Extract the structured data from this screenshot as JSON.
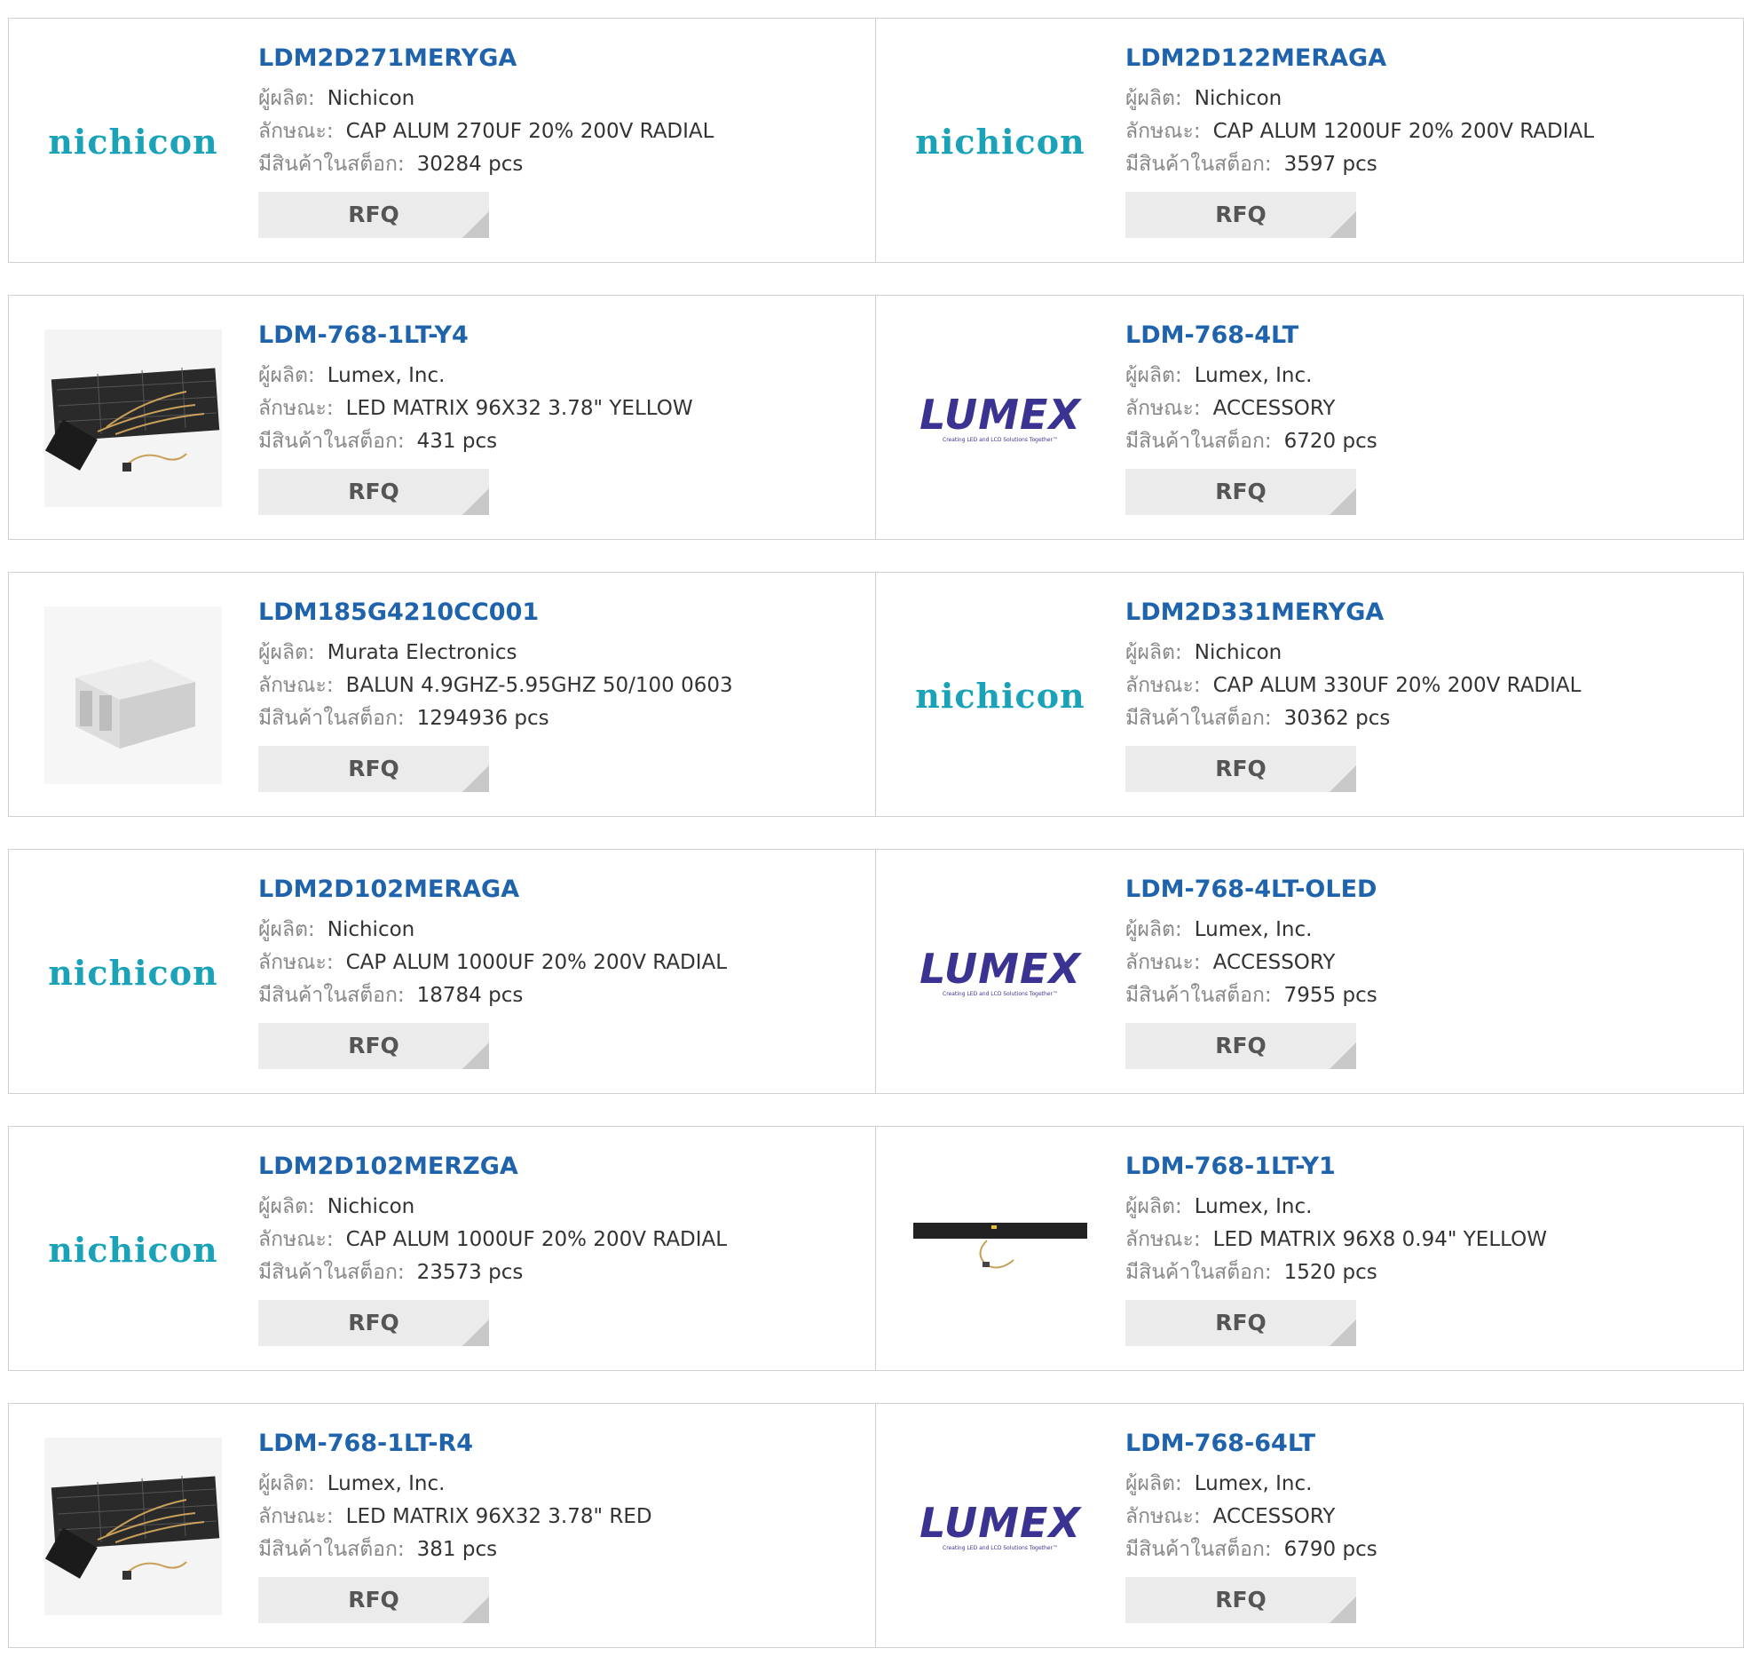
{
  "labels": {
    "manufacturer": "ผู้ผลิต:",
    "description": "ลักษณะ:",
    "stock": "มีสินค้าในสต็อก:",
    "rfq": "RFQ"
  },
  "logos": {
    "nichicon": "nichicon",
    "lumex": "LUMEX",
    "lumex_tagline": "Creating LED and LCD Solutions Together™"
  },
  "colors": {
    "title": "#1f63ad",
    "nichicon": "#1aa3b8",
    "lumex": "#3a3392"
  },
  "products": [
    {
      "part": "LDM2D271MERYGA",
      "manufacturer": "Nichicon",
      "description": "CAP ALUM 270UF 20% 200V RADIAL",
      "stock": "30284 pcs",
      "image": "nichicon-logo"
    },
    {
      "part": "LDM2D122MERAGA",
      "manufacturer": "Nichicon",
      "description": "CAP ALUM 1200UF 20% 200V RADIAL",
      "stock": "3597 pcs",
      "image": "nichicon-logo"
    },
    {
      "part": "LDM-768-1LT-Y4",
      "manufacturer": "Lumex, Inc.",
      "description": "LED MATRIX 96X32 3.78\" YELLOW",
      "stock": "431 pcs",
      "image": "led-matrix-large-photo"
    },
    {
      "part": "LDM-768-4LT",
      "manufacturer": "Lumex, Inc.",
      "description": "ACCESSORY",
      "stock": "6720 pcs",
      "image": "lumex-logo"
    },
    {
      "part": "LDM185G4210CC001",
      "manufacturer": "Murata Electronics",
      "description": "BALUN 4.9GHZ-5.95GHZ 50/100 0603",
      "stock": "1294936 pcs",
      "image": "balun-chip-photo"
    },
    {
      "part": "LDM2D331MERYGA",
      "manufacturer": "Nichicon",
      "description": "CAP ALUM 330UF 20% 200V RADIAL",
      "stock": "30362 pcs",
      "image": "nichicon-logo"
    },
    {
      "part": "LDM2D102MERAGA",
      "manufacturer": "Nichicon",
      "description": "CAP ALUM 1000UF 20% 200V RADIAL",
      "stock": "18784 pcs",
      "image": "nichicon-logo"
    },
    {
      "part": "LDM-768-4LT-OLED",
      "manufacturer": "Lumex, Inc.",
      "description": "ACCESSORY",
      "stock": "7955 pcs",
      "image": "lumex-logo"
    },
    {
      "part": "LDM2D102MERZGA",
      "manufacturer": "Nichicon",
      "description": "CAP ALUM 1000UF 20% 200V RADIAL",
      "stock": "23573 pcs",
      "image": "nichicon-logo"
    },
    {
      "part": "LDM-768-1LT-Y1",
      "manufacturer": "Lumex, Inc.",
      "description": "LED MATRIX 96X8 0.94\" YELLOW",
      "stock": "1520 pcs",
      "image": "led-matrix-bar-photo"
    },
    {
      "part": "LDM-768-1LT-R4",
      "manufacturer": "Lumex, Inc.",
      "description": "LED MATRIX 96X32 3.78\" RED",
      "stock": "381 pcs",
      "image": "led-matrix-large-photo"
    },
    {
      "part": "LDM-768-64LT",
      "manufacturer": "Lumex, Inc.",
      "description": "ACCESSORY",
      "stock": "6790 pcs",
      "image": "lumex-logo"
    }
  ]
}
